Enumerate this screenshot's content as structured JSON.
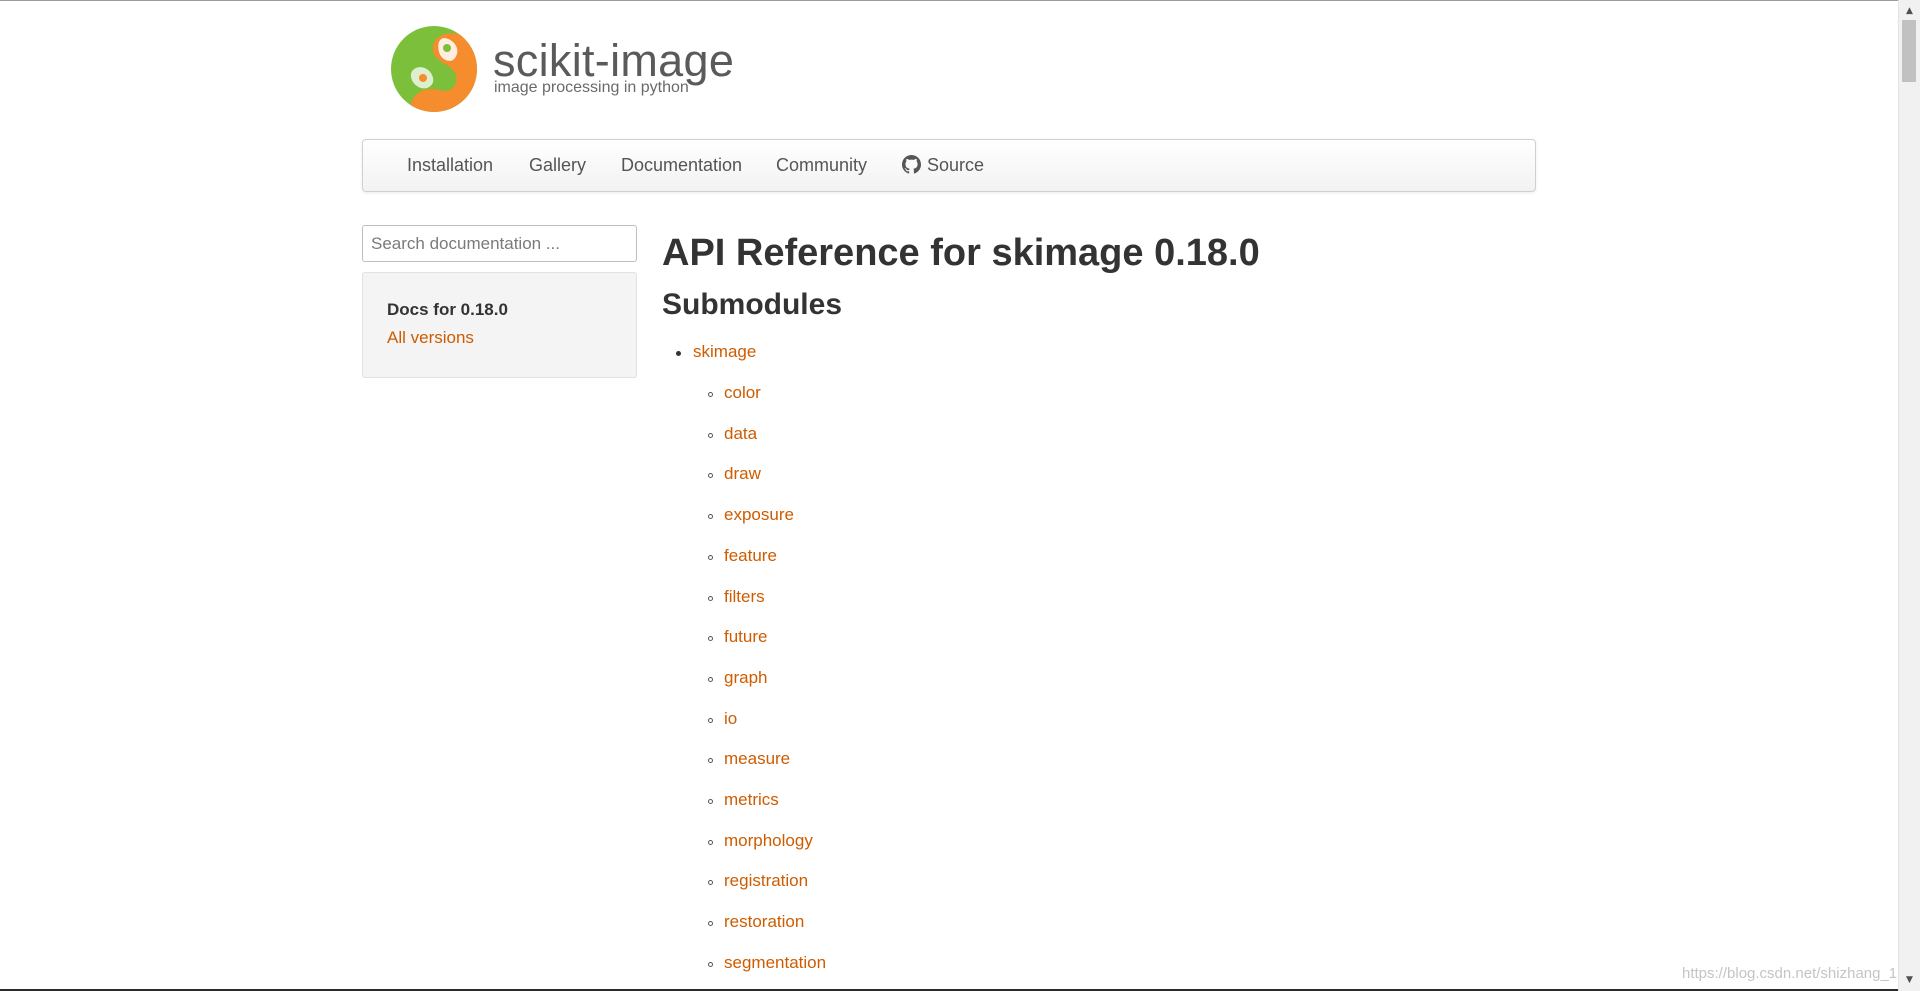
{
  "brand": {
    "name": "scikit-image",
    "tagline": "image processing in python"
  },
  "navbar": {
    "items": [
      {
        "label": "Installation"
      },
      {
        "label": "Gallery"
      },
      {
        "label": "Documentation"
      },
      {
        "label": "Community"
      },
      {
        "label": "Source",
        "icon": "github-icon"
      }
    ]
  },
  "sidebar": {
    "search_placeholder": "Search documentation ...",
    "docs_version_label": "Docs for 0.18.0",
    "all_versions_link": "All versions"
  },
  "main": {
    "title": "API Reference for skimage 0.18.0",
    "section_heading": "Submodules",
    "top_module": "skimage",
    "submodules": [
      "color",
      "data",
      "draw",
      "exposure",
      "feature",
      "filters",
      "future",
      "graph",
      "io",
      "measure",
      "metrics",
      "morphology",
      "registration",
      "restoration",
      "segmentation"
    ]
  },
  "watermark": "https://blog.csdn.net/shizhang_1",
  "colors": {
    "link": "#ce5c00",
    "logo_green": "#7cbf3b",
    "logo_orange": "#f58c2e"
  }
}
